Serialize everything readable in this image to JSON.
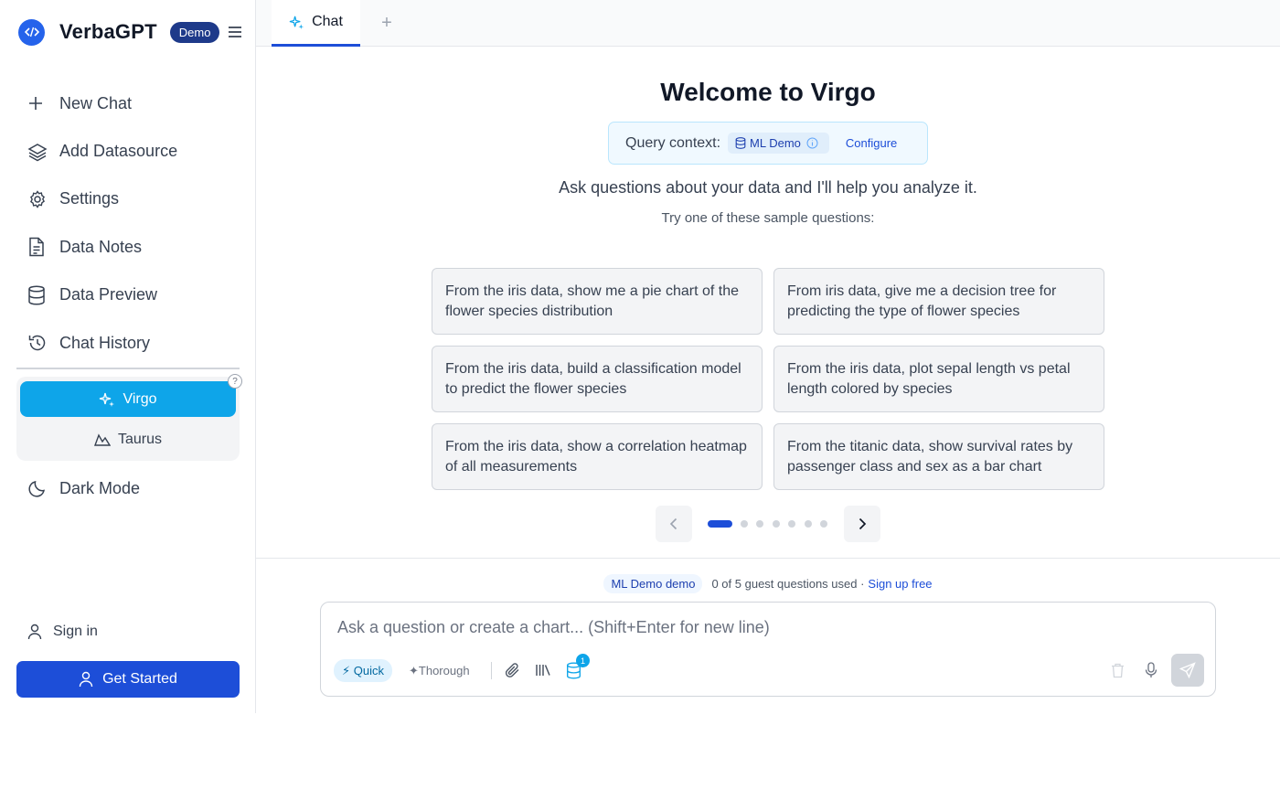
{
  "sidebar": {
    "brand_name": "VerbaGPT",
    "demo_badge": "Demo",
    "items": [
      {
        "label": "New Chat",
        "icon": "plus-icon"
      },
      {
        "label": "Add Datasource",
        "icon": "layers-icon"
      },
      {
        "label": "Settings",
        "icon": "gear-icon"
      },
      {
        "label": "Data Notes",
        "icon": "document-icon"
      },
      {
        "label": "Data Preview",
        "icon": "database-icon"
      },
      {
        "label": "Chat History",
        "icon": "history-icon"
      }
    ],
    "help_glyph": "?",
    "agents": [
      {
        "label": "Virgo",
        "selected": true
      },
      {
        "label": "Taurus",
        "selected": false
      }
    ],
    "dark_mode_label": "Dark Mode",
    "sign_in_label": "Sign in",
    "get_started_label": "Get Started"
  },
  "tabs": {
    "chat_label": "Chat",
    "add_glyph": "+"
  },
  "main": {
    "welcome": "Welcome to Virgo",
    "query_context_label": "Query context:",
    "datasource": "ML Demo",
    "configure_label": "Configure",
    "subtitle": "Ask questions about your data and I'll help you analyze it.",
    "try_label": "Try one of these sample questions:",
    "samples": [
      "From the iris data, show me a pie chart of the flower species distribution",
      "From iris data, give me a decision tree for predicting the type of flower species",
      "From the iris data, build a classification model to predict the flower species",
      "From the iris data, plot sepal length vs petal length colored by species",
      "From the iris data, show a correlation heatmap of all measurements",
      "From the titanic data, show survival rates by passenger class and sex as a bar chart"
    ],
    "pager": {
      "pages": 7,
      "current": 1
    }
  },
  "composer": {
    "demo_pill": "ML Demo demo",
    "usage": "0 of 5 guest questions used ·",
    "signup": "Sign up free",
    "placeholder": "Ask a question or create a chart... (Shift+Enter for new line)",
    "mode_quick": "⚡ Quick",
    "mode_thorough": "✦Thorough",
    "datasource_count": "1"
  },
  "colors": {
    "accent": "#1d4ed8",
    "agent_selected": "#0ea5e9",
    "brand_dark": "#1e3a8a"
  }
}
